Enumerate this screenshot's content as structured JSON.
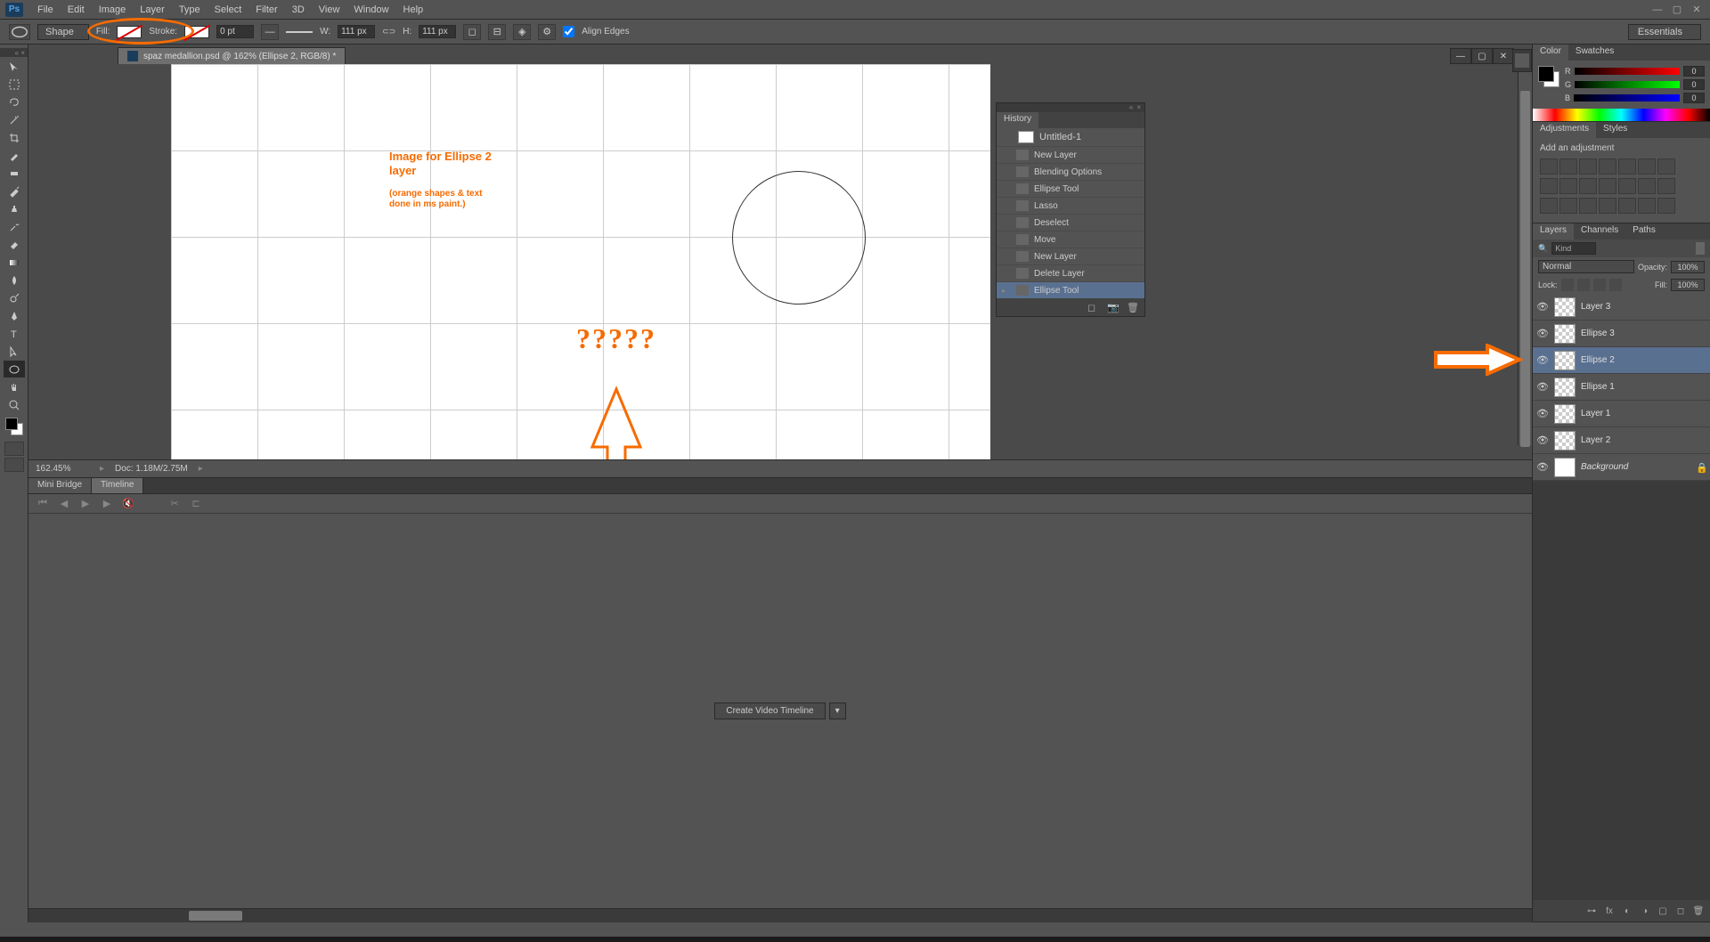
{
  "menu": {
    "items": [
      "File",
      "Edit",
      "Image",
      "Layer",
      "Type",
      "Select",
      "Filter",
      "3D",
      "View",
      "Window",
      "Help"
    ]
  },
  "options_bar": {
    "shape_mode": "Shape",
    "fill_label": "Fill:",
    "stroke_label": "Stroke:",
    "stroke_pt": "0 pt",
    "w_label": "W:",
    "w_value": "111 px",
    "h_label": "H:",
    "h_value": "111 px",
    "align_edges_label": "Align Edges",
    "workspace": "Essentials"
  },
  "document": {
    "tab_title": "spaz medallion.psd @ 162% (Ellipse 2, RGB/8) *"
  },
  "canvas_annotations": {
    "title_line1": "Image for Ellipse 2 layer",
    "note_line": "(orange shapes & text done in ms paint.)",
    "question_marks": "?????"
  },
  "status": {
    "zoom": "162.45%",
    "doc_info": "Doc: 1.18M/2.75M"
  },
  "bottom_tabs": {
    "mini_bridge": "Mini Bridge",
    "timeline": "Timeline"
  },
  "timeline": {
    "create_button": "Create Video Timeline"
  },
  "color_panel": {
    "tab_color": "Color",
    "tab_swatches": "Swatches",
    "r_label": "R",
    "g_label": "G",
    "b_label": "B",
    "r_val": "0",
    "g_val": "0",
    "b_val": "0"
  },
  "adjustments_panel": {
    "tab_adjustments": "Adjustments",
    "tab_styles": "Styles",
    "add_label": "Add an adjustment"
  },
  "layers_panel": {
    "tab_layers": "Layers",
    "tab_channels": "Channels",
    "tab_paths": "Paths",
    "filter_kind": "Kind",
    "blend_mode": "Normal",
    "opacity_label": "Opacity:",
    "opacity_val": "100%",
    "lock_label": "Lock:",
    "fill_label": "Fill:",
    "fill_val": "100%",
    "layers": [
      {
        "name": "Layer 3",
        "selected": false,
        "thumb": "checker"
      },
      {
        "name": "Ellipse 3",
        "selected": false,
        "thumb": "checker"
      },
      {
        "name": "Ellipse 2",
        "selected": true,
        "thumb": "checker"
      },
      {
        "name": "Ellipse 1",
        "selected": false,
        "thumb": "checker"
      },
      {
        "name": "Layer 1",
        "selected": false,
        "thumb": "pattern"
      },
      {
        "name": "Layer 2",
        "selected": false,
        "thumb": "pattern"
      },
      {
        "name": "Background",
        "selected": false,
        "thumb": "white",
        "italic": true,
        "locked": true
      }
    ]
  },
  "history_panel": {
    "tab": "History",
    "snapshot": "Untitled-1",
    "items": [
      {
        "name": "New Layer"
      },
      {
        "name": "Blending Options"
      },
      {
        "name": "Ellipse Tool"
      },
      {
        "name": "Lasso"
      },
      {
        "name": "Deselect"
      },
      {
        "name": "Move"
      },
      {
        "name": "New Layer"
      },
      {
        "name": "Delete Layer"
      },
      {
        "name": "Ellipse Tool",
        "selected": true
      }
    ]
  }
}
